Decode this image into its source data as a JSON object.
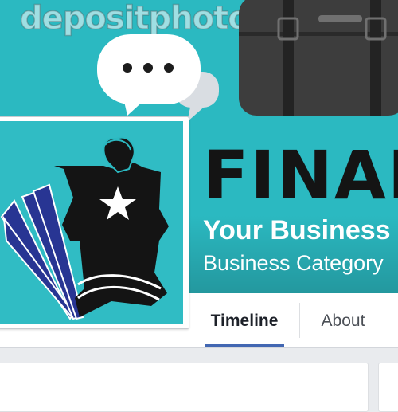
{
  "watermark": "depositphotos",
  "cover": {
    "brand_title": "FINAN",
    "business_name": "Your Business",
    "business_category": "Business Category"
  },
  "nav": {
    "tabs": [
      {
        "label": "Timeline",
        "active": true
      },
      {
        "label": "About",
        "active": false
      }
    ]
  },
  "colors": {
    "cover_bg": "#2bb9c1",
    "active_tab_underline": "#4267b2",
    "logo_dark": "#141414",
    "logo_blue": "#283593"
  },
  "icons": [
    "speech-bubble-icon",
    "briefcase-icon",
    "superhero-logo",
    "star-icon"
  ]
}
